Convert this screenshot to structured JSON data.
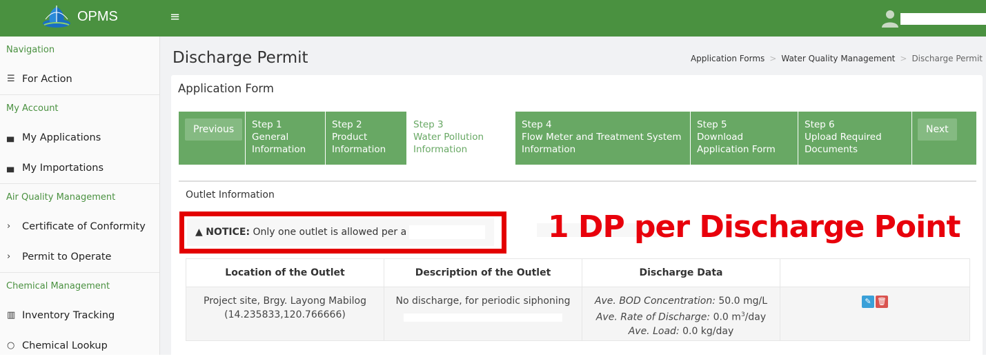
{
  "app": {
    "name": "OPMS",
    "menu_icon": "≡"
  },
  "sidebar": {
    "sections": [
      {
        "header": "Navigation",
        "items": [
          {
            "label": "For Action",
            "icon": "list-icon"
          }
        ]
      },
      {
        "header": "My Account",
        "items": [
          {
            "label": "My Applications",
            "icon": "box-icon"
          },
          {
            "label": "My Importations",
            "icon": "box-icon"
          }
        ]
      },
      {
        "header": "Air Quality Management",
        "items": [
          {
            "label": "Certificate of Conformity",
            "icon": "chevron-right-icon"
          },
          {
            "label": "Permit to Operate",
            "icon": "chevron-right-icon"
          }
        ]
      },
      {
        "header": "Chemical Management",
        "items": [
          {
            "label": "Inventory Tracking",
            "icon": "bar-chart-icon"
          },
          {
            "label": "Chemical Lookup",
            "icon": "circle-icon"
          }
        ]
      }
    ]
  },
  "page": {
    "title": "Discharge Permit",
    "breadcrumb": [
      "Application Forms",
      "Water Quality Management",
      "Discharge Permit"
    ]
  },
  "panel": {
    "title": "Application Form"
  },
  "wizard": {
    "previous_label": "Previous",
    "next_label": "Next",
    "steps": [
      {
        "lines": [
          "Step 1",
          "General",
          "Information"
        ]
      },
      {
        "lines": [
          "Step 2",
          "Product",
          "Information"
        ]
      },
      {
        "lines": [
          "Step 3",
          "Water Pollution",
          "Information"
        ],
        "active": true
      },
      {
        "lines": [
          "Step 4",
          "Flow Meter and Treatment System",
          "Information"
        ]
      },
      {
        "lines": [
          "Step 5",
          "Download",
          "Application Form"
        ]
      },
      {
        "lines": [
          "Step 6",
          "Upload Required",
          "Documents"
        ]
      }
    ]
  },
  "outlet": {
    "section_title": "Outlet Information",
    "notice_prefix": "NOTICE:",
    "notice_text": "Only one outlet is allowed per a",
    "annotation": "1 DP per Discharge Point",
    "table": {
      "headers": [
        "Location of the Outlet",
        "Description of the Outlet",
        "Discharge Data",
        ""
      ],
      "rows": [
        {
          "location_line1": "Project site, Brgy. Layong Mabilog",
          "location_line2": "(14.235833,120.766666)",
          "description": "No discharge, for periodic siphoning",
          "bod_label": "Ave. BOD Concentration:",
          "bod_value": "50.0 mg/L",
          "rate_label": "Ave. Rate of Discharge:",
          "rate_value": "0.0 m",
          "rate_sup": "3",
          "rate_unit": "/day",
          "load_label": "Ave. Load:",
          "load_value": "0.0 kg/day"
        }
      ]
    }
  },
  "colors": {
    "brand_green": "#4a9140",
    "step_green": "#68a864",
    "annotation_red": "#e30000"
  }
}
